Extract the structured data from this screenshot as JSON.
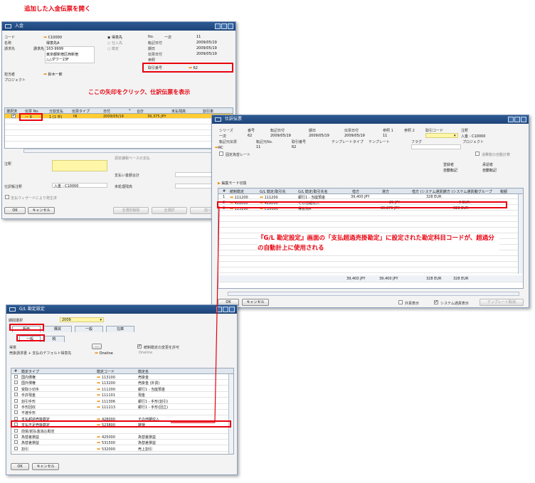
{
  "annotations": {
    "top_heading": "追加した入金伝票を開く",
    "middle_note": "ここの矢印をクリック、仕訳伝票を表示",
    "bottom_note": "『G/L 勘定設定』画面の「支払超過売掛勘定」に設定された勘定科目コードが、超過分の自動計上に使用される"
  },
  "payment_window": {
    "title": "入金",
    "fields": {
      "code_label": "コード",
      "code_value": "C10000",
      "name_label": "名称",
      "name_value": "得意先A",
      "address_label": "請求先",
      "address_pick": "請求先",
      "address_lines": [
        "163-9999",
        "東京都新宿区西新宿",
        "△△ダワー23F"
      ],
      "contact_label": "担当者",
      "contact_value": "鈴木一郎",
      "project_label": "プロジェクト"
    },
    "radios": [
      "得意先",
      "仕入先",
      "勘定"
    ],
    "right": {
      "no_label": "No.",
      "no_series": "一次",
      "no_value": "11",
      "posting_label": "転記日付",
      "posting_value": "2009/05/19",
      "due_label": "期日",
      "due_value": "2009/05/19",
      "doc_date_label": "伝票日付",
      "doc_date_value": "2009/05/19",
      "ref_label": "参照",
      "journal_no_label": "取引番号",
      "journal_no_value": "62"
    },
    "table": {
      "headers": [
        "選択済",
        "伝票 No.",
        "分割支払",
        "伝票タイプ",
        "日付",
        "*",
        "合計",
        "未払残高",
        "割引率"
      ],
      "row": {
        "doc_no": "9",
        "split": "1 (1 中)",
        "type": "IN",
        "date": "2009/05/19",
        "total": "39,375 JPY"
      }
    },
    "bottom": {
      "note_label": "注釈",
      "deduct_label": "源泉課税ベースの支払",
      "total_paid_label": "支払い金額合計",
      "journal_label": "仕訳帳注釈",
      "journal_value": "入金 - C10000",
      "open_balance_label": "未処理残高",
      "wizard_label": "支払ウィザードにより発生済",
      "ok": "OK",
      "cancel": "キャンセル",
      "select_all": "全選択解除",
      "select": "全選択",
      "copy": "前へ"
    }
  },
  "journal_window": {
    "title": "仕訳伝票",
    "headers": {
      "series_label": "シリーズ",
      "series_value": "一次",
      "number_label": "番号",
      "number_value": "62",
      "posting_label": "転記日付",
      "posting_value": "2009/05/19",
      "due_label": "期日",
      "due_value": "2009/05/19",
      "docdate_label": "伝票日付",
      "docdate_value": "2009/05/19",
      "ref1_label": "参照 1",
      "ref1_value": "11",
      "ref2_label": "参照 2",
      "txcode_label": "取引コード",
      "remarks_label": "注釈",
      "remarks_value": "入金 - C10000",
      "origin_label": "転記元伝票",
      "origin_value": "RC",
      "origin_no_label": "転記元No.",
      "origin_no_value": "11",
      "trans_no_label": "取引番号",
      "trans_no_value": "62",
      "template_type_label": "テンプレートタイプ",
      "template_label": "テンプレート",
      "indicator_label": "フラグ",
      "project_label": "プロジェクト",
      "fixed_rate_label": "固定為替レート",
      "auto_tax_label": "消費税の自動計算",
      "reg_label": "登録者",
      "reg_value": "自動転記",
      "approve_label": "承認者",
      "approve_value": "自動転記"
    },
    "mode_label": "編集モード切換",
    "table": {
      "headers": [
        "#",
        "統制勘定",
        "G/L 勘定/取引先",
        "G/L 勘定/取引先名",
        "借方",
        "貸方",
        "借方 (システム通貨)",
        "貸方 (システム通貨)",
        "税グループ",
        "税額"
      ],
      "rows": [
        {
          "n": "1",
          "ctrl": "111200",
          "gl": "111200",
          "name": "銀行1 - 当座預金",
          "debit": "39,400 JPY",
          "credit": "",
          "debit_sys": "328 EUR",
          "credit_sys": ""
        },
        {
          "n": "2",
          "ctrl": "428000",
          "gl": "428000",
          "name": "その他雑収入",
          "debit": "",
          "credit": "25 JPY",
          "debit_sys": "",
          "credit_sys": "0 EUR"
        },
        {
          "n": "3",
          "ctrl": "113100",
          "gl": "C10000",
          "name": "得意先A",
          "debit": "",
          "credit": "39,375 JPY",
          "debit_sys": "",
          "credit_sys": "328 EUR"
        }
      ],
      "totals": {
        "debit": "39,400 JPY",
        "credit": "39,400 JPY",
        "debit_sys": "328 EUR",
        "credit_sys": "328 EUR"
      }
    },
    "bottom": {
      "ok": "OK",
      "cancel": "キャンセル",
      "foreign_label": "外貨表示",
      "system_label": "システム通貨表示",
      "template_btn": "テンプレート取消"
    }
  },
  "gl_window": {
    "title": "G/L 勘定設定",
    "period_label": "期間選択",
    "period_value": "2009",
    "tabs": [
      "販売",
      "購買",
      "一般",
      "在庫"
    ],
    "subtabs": [
      "一般",
      "税"
    ],
    "top_fields": {
      "group_label": "得意",
      "default_label": "売掛請求書 + 支払のデフォルト得意先",
      "default_value": "Oneline",
      "default_value2": "Oneline",
      "allow_label": "統制勘定の変更を許可"
    },
    "table": {
      "headers": [
        "#",
        "勘定タイプ",
        "勘定コード",
        "勘定名"
      ],
      "rows": [
        {
          "type": "国内債権",
          "code": "113100",
          "name": "売掛金"
        },
        {
          "type": "国外債権",
          "code": "113200",
          "name": "売掛金 (外貨)"
        },
        {
          "type": "受取小切手",
          "code": "111200",
          "name": "銀行1 - 当座預金"
        },
        {
          "type": "手許現金",
          "code": "111101",
          "name": "現金"
        },
        {
          "type": "割引手形",
          "code": "111306",
          "name": "銀行1 - 手形(割引)"
        },
        {
          "type": "手形回収",
          "code": "111213",
          "name": "銀行1 - 手形(回立)"
        },
        {
          "type": "不渡手形",
          "code": "",
          "name": ""
        },
        {
          "type": "支払超過売掛勘定",
          "code": "428000",
          "name": "その他雑収入"
        },
        {
          "type": "支払不足売掛勘定",
          "code": "523800",
          "name": "雑損"
        },
        {
          "type": "前受/前払金消込勘定",
          "code": "",
          "name": ""
        },
        {
          "type": "為替差損益",
          "code": "425000",
          "name": "為替差損益"
        },
        {
          "type": "為替差損益",
          "code": "531500",
          "name": "為替差損益"
        },
        {
          "type": "割引",
          "code": "532000",
          "name": "売上割引"
        }
      ]
    },
    "ok": "OK",
    "cancel": "キャンセル"
  },
  "colors": {
    "annotation_red": "#e8000e",
    "titlebar": "#1e4478",
    "highlight_row": "#ffcc33",
    "arrow": "#e98a00"
  }
}
